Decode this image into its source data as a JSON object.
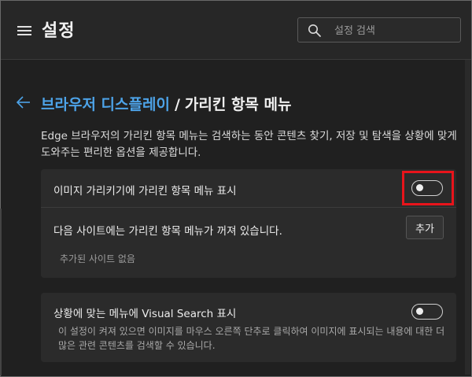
{
  "header": {
    "title": "설정",
    "search_placeholder": "설정 검색"
  },
  "breadcrumb": {
    "parent": "브라우저 디스플레이",
    "separator": "/",
    "current": "가리킨 항목 메뉴"
  },
  "description": "Edge 브라우저의 가리킨 항목 메뉴는 검색하는 동안 콘텐츠 찾기, 저장 및 탐색을 상황에 맞게 도와주는 편리한 옵션을 제공합니다.",
  "card1": {
    "toggle_label": "이미지 가리키기에 가리킨 항목 메뉴 표시",
    "toggle_state": "off",
    "sites_label": "다음 사이트에는 가리킨 항목 메뉴가 꺼져 있습니다.",
    "add_button": "추가",
    "empty_text": "추가된 사이트 없음"
  },
  "card2": {
    "toggle_label": "상황에 맞는 메뉴에 Visual Search 표시",
    "toggle_state": "off",
    "description": "이 설정이 켜져 있으면 이미지를 마우스 오른쪽 단추로 클릭하여 이미지에 표시되는 내용에 대한 더 많은 관련 콘텐츠를 검색할 수 있습니다."
  },
  "colors": {
    "accent_link": "#4da3e8",
    "highlight": "#e8141b",
    "background": "#202020",
    "card": "#2b2b2b"
  },
  "icons": {
    "menu": "hamburger-menu-icon",
    "search": "search-icon",
    "back": "back-arrow-icon"
  }
}
